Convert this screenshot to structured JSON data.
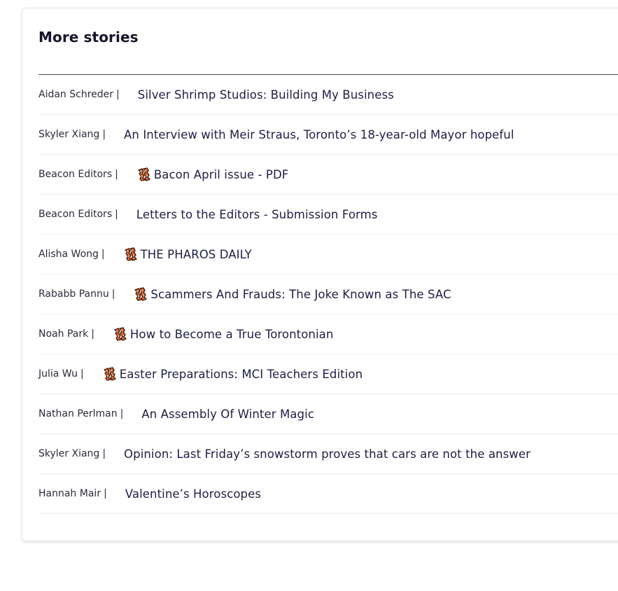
{
  "section": {
    "title": "More stories"
  },
  "stories": [
    {
      "author": "Aidan Schreder",
      "separator": "|",
      "title": "Silver Shrimp Studios: Building My Business",
      "icon": ""
    },
    {
      "author": "Skyler Xiang",
      "separator": "|",
      "title": "An Interview with Meir Straus, Toronto’s 18-year-old Mayor hopeful",
      "icon": ""
    },
    {
      "author": "Beacon Editors",
      "separator": "|",
      "title": "Bacon April issue - PDF",
      "icon": "bacon-icon"
    },
    {
      "author": "Beacon Editors",
      "separator": "|",
      "title": "Letters to the Editors - Submission Forms",
      "icon": ""
    },
    {
      "author": "Alisha Wong",
      "separator": "|",
      "title": "THE PHAROS DAILY",
      "icon": "bacon-icon"
    },
    {
      "author": "Rababb Pannu",
      "separator": "|",
      "title": "Scammers And Frauds: The Joke Known as The SAC",
      "icon": "bacon-icon"
    },
    {
      "author": "Noah Park",
      "separator": "|",
      "title": "How to Become a True Torontonian",
      "icon": "bacon-icon"
    },
    {
      "author": "Julia Wu",
      "separator": "|",
      "title": "Easter Preparations: MCI Teachers Edition",
      "icon": "bacon-icon"
    },
    {
      "author": "Nathan Perlman",
      "separator": "|",
      "title": "An Assembly Of Winter Magic",
      "icon": ""
    },
    {
      "author": "Skyler Xiang",
      "separator": "|",
      "title": "Opinion: Last Friday’s snowstorm proves that cars are not the answer",
      "icon": ""
    },
    {
      "author": "Hannah Mair",
      "separator": "|",
      "title": "Valentine’s Horoscopes",
      "icon": ""
    }
  ],
  "colors": {
    "link": "#1e1e45",
    "author": "#2b2b3c",
    "bacon_fill": "#f06a2a",
    "bacon_outline": "#3a1a10"
  }
}
